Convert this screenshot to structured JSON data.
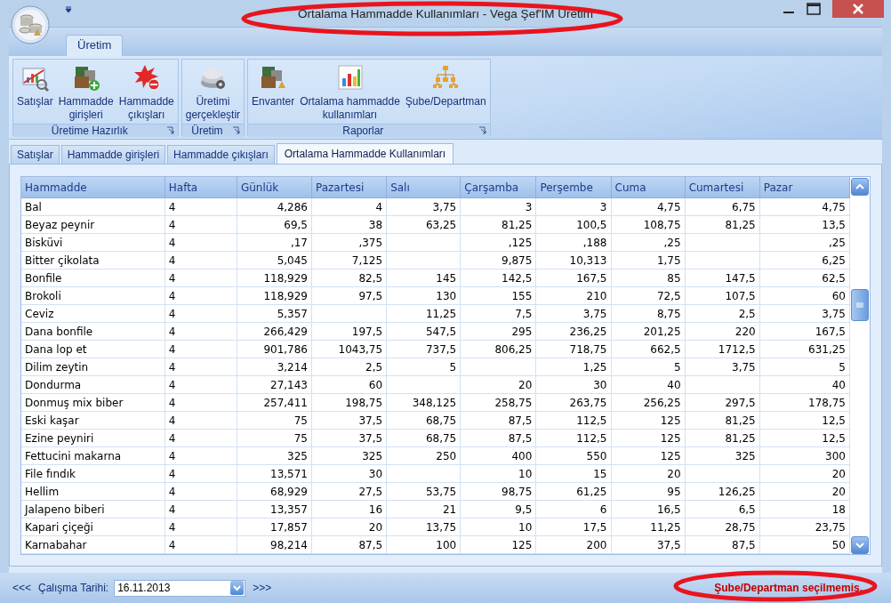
{
  "window": {
    "title": "Ortalama Hammadde Kullanımları - Vega Şef'IM Üretim"
  },
  "ribbon": {
    "tabs": [
      {
        "label": "Üretim",
        "selected": true
      }
    ],
    "groups": [
      {
        "title": "Üretime Hazırlık",
        "items": [
          {
            "label": [
              "Satışlar"
            ]
          },
          {
            "label": [
              "Hammadde",
              "girişleri"
            ]
          },
          {
            "label": [
              "Hammadde",
              "çıkışları"
            ]
          }
        ]
      },
      {
        "title": "Üretim",
        "items": [
          {
            "label": [
              "Üretimi",
              "gerçekleştir"
            ]
          }
        ]
      },
      {
        "title": "Raporlar",
        "items": [
          {
            "label": [
              "Envanter"
            ]
          },
          {
            "label": [
              "Ortalama hammadde",
              "kullanımları"
            ]
          },
          {
            "label": [
              "Şube/Departman"
            ]
          }
        ]
      }
    ]
  },
  "document_tabs": [
    {
      "label": "Satışlar",
      "selected": false
    },
    {
      "label": "Hammadde girişleri",
      "selected": false
    },
    {
      "label": "Hammadde çıkışları",
      "selected": false
    },
    {
      "label": "Ortalama Hammadde Kullanımları",
      "selected": true
    }
  ],
  "table": {
    "columns": [
      "Hammadde",
      "Hafta",
      "Günlük",
      "Pazartesi",
      "Salı",
      "Çarşamba",
      "Perşembe",
      "Cuma",
      "Cumartesi",
      "Pazar"
    ],
    "rows": [
      {
        "cells": [
          "Bal",
          "4",
          "4,286",
          "4",
          "3,75",
          "3",
          "3",
          "4,75",
          "6,75",
          "4,75"
        ]
      },
      {
        "cells": [
          "Beyaz peynir",
          "4",
          "69,5",
          "38",
          "63,25",
          "81,25",
          "100,5",
          "108,75",
          "81,25",
          "13,5"
        ]
      },
      {
        "cells": [
          "Bisküvi",
          "4",
          ",17",
          ",375",
          null,
          ",125",
          ",188",
          ",25",
          null,
          ",25"
        ]
      },
      {
        "cells": [
          "Bitter çikolata",
          "4",
          "5,045",
          "7,125",
          null,
          "9,875",
          "10,313",
          "1,75",
          null,
          "6,25"
        ]
      },
      {
        "cells": [
          "Bonfile",
          "4",
          "118,929",
          "82,5",
          "145",
          "142,5",
          "167,5",
          "85",
          "147,5",
          "62,5"
        ]
      },
      {
        "cells": [
          "Brokoli",
          "4",
          "118,929",
          "97,5",
          "130",
          "155",
          "210",
          "72,5",
          "107,5",
          "60"
        ]
      },
      {
        "cells": [
          "Ceviz",
          "4",
          "5,357",
          null,
          "11,25",
          "7,5",
          "3,75",
          "8,75",
          "2,5",
          "3,75"
        ]
      },
      {
        "cells": [
          "Dana bonfile",
          "4",
          "266,429",
          "197,5",
          "547,5",
          "295",
          "236,25",
          "201,25",
          "220",
          "167,5"
        ]
      },
      {
        "cells": [
          "Dana lop et",
          "4",
          "901,786",
          "1043,75",
          "737,5",
          "806,25",
          "718,75",
          "662,5",
          "1712,5",
          "631,25"
        ]
      },
      {
        "cells": [
          "Dilim zeytin",
          "4",
          "3,214",
          "2,5",
          "5",
          null,
          "1,25",
          "5",
          "3,75",
          "5"
        ]
      },
      {
        "cells": [
          "Dondurma",
          "4",
          "27,143",
          "60",
          null,
          "20",
          "30",
          "40",
          null,
          "40"
        ]
      },
      {
        "cells": [
          "Donmuş mix biber",
          "4",
          "257,411",
          "198,75",
          "348,125",
          "258,75",
          "263,75",
          "256,25",
          "297,5",
          "178,75"
        ]
      },
      {
        "cells": [
          "Eski kaşar",
          "4",
          "75",
          "37,5",
          "68,75",
          "87,5",
          "112,5",
          "125",
          "81,25",
          "12,5"
        ]
      },
      {
        "cells": [
          "Ezine peyniri",
          "4",
          "75",
          "37,5",
          "68,75",
          "87,5",
          "112,5",
          "125",
          "81,25",
          "12,5"
        ]
      },
      {
        "cells": [
          "Fettucini makarna",
          "4",
          "325",
          "325",
          "250",
          "400",
          "550",
          "125",
          "325",
          "300"
        ]
      },
      {
        "cells": [
          "File fındık",
          "4",
          "13,571",
          "30",
          null,
          "10",
          "15",
          "20",
          null,
          "20"
        ]
      },
      {
        "cells": [
          "Hellim",
          "4",
          "68,929",
          "27,5",
          "53,75",
          "98,75",
          "61,25",
          "95",
          "126,25",
          "20"
        ]
      },
      {
        "cells": [
          "Jalapeno biberi",
          "4",
          "13,357",
          "16",
          "21",
          "9,5",
          "6",
          "16,5",
          "6,5",
          "18"
        ]
      },
      {
        "cells": [
          "Kapari çiçeği",
          "4",
          "17,857",
          "20",
          "13,75",
          "10",
          "17,5",
          "11,25",
          "28,75",
          "23,75"
        ]
      },
      {
        "cells": [
          "Karnabahar",
          "4",
          "98,214",
          "87,5",
          "100",
          "125",
          "200",
          "37,5",
          "87,5",
          "50"
        ]
      }
    ]
  },
  "status_bar": {
    "prev": "<<<",
    "date_label": "Çalışma Tarihi:",
    "date_value": "16.11.2013",
    "next": ">>>",
    "message": "Şube/Departman seçilmemiş."
  }
}
